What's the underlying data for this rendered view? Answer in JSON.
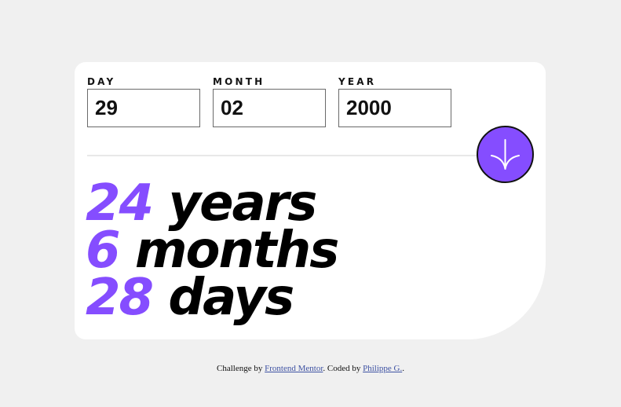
{
  "form": {
    "fields": [
      {
        "label": "DAY",
        "value": "29"
      },
      {
        "label": "MONTH",
        "value": "02"
      },
      {
        "label": "YEAR",
        "value": "2000"
      }
    ],
    "submit_icon": "arrow-down-icon"
  },
  "results": [
    {
      "value": "24",
      "unit": "years"
    },
    {
      "value": "6",
      "unit": "months"
    },
    {
      "value": "28",
      "unit": "days"
    }
  ],
  "footer": {
    "prefix": "Challenge by ",
    "link1": "Frontend Mentor",
    "middle": ". Coded by ",
    "link2": "Philippe G.",
    "suffix": "."
  },
  "colors": {
    "background": "#f0f0f0",
    "card": "#ffffff",
    "accent": "#854dff",
    "text": "#141414"
  }
}
